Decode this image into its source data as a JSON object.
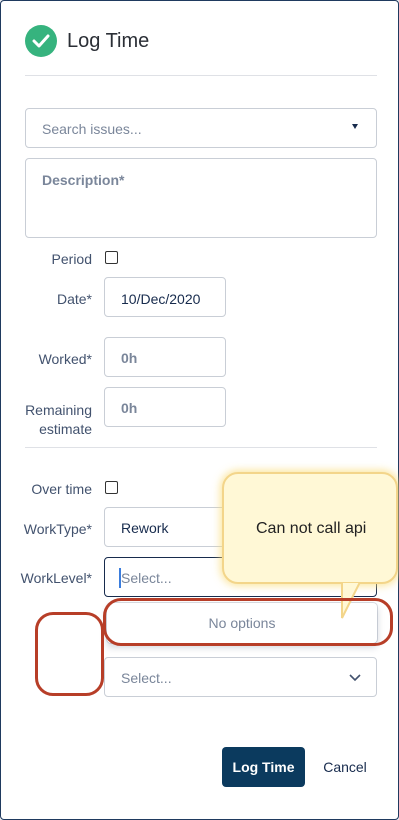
{
  "header": {
    "title": "Log Time"
  },
  "search": {
    "placeholder": "Search issues..."
  },
  "description": {
    "placeholder": "Description*"
  },
  "period": {
    "label": "Period"
  },
  "date": {
    "label": "Date*",
    "value": "10/Dec/2020"
  },
  "worked": {
    "label": "Worked*",
    "placeholder": "0h"
  },
  "remaining": {
    "label_line1": "Remaining",
    "label_line2": "estimate",
    "placeholder": "0h"
  },
  "overtime": {
    "label": "Over time"
  },
  "worktype": {
    "label": "WorkType*",
    "value": "Rework"
  },
  "worklevel": {
    "label": "WorkLevel*",
    "placeholder": "Select..."
  },
  "dropdown_menu": {
    "empty_text": "No options"
  },
  "extra_select": {
    "placeholder": "Select..."
  },
  "footer": {
    "primary_label": "Log Time",
    "cancel_label": "Cancel"
  },
  "annotation": {
    "callout_text": "Can not call api"
  },
  "colors": {
    "accent": "#0b3a5e",
    "success": "#36b37e",
    "annotation_red": "#b73e28"
  }
}
